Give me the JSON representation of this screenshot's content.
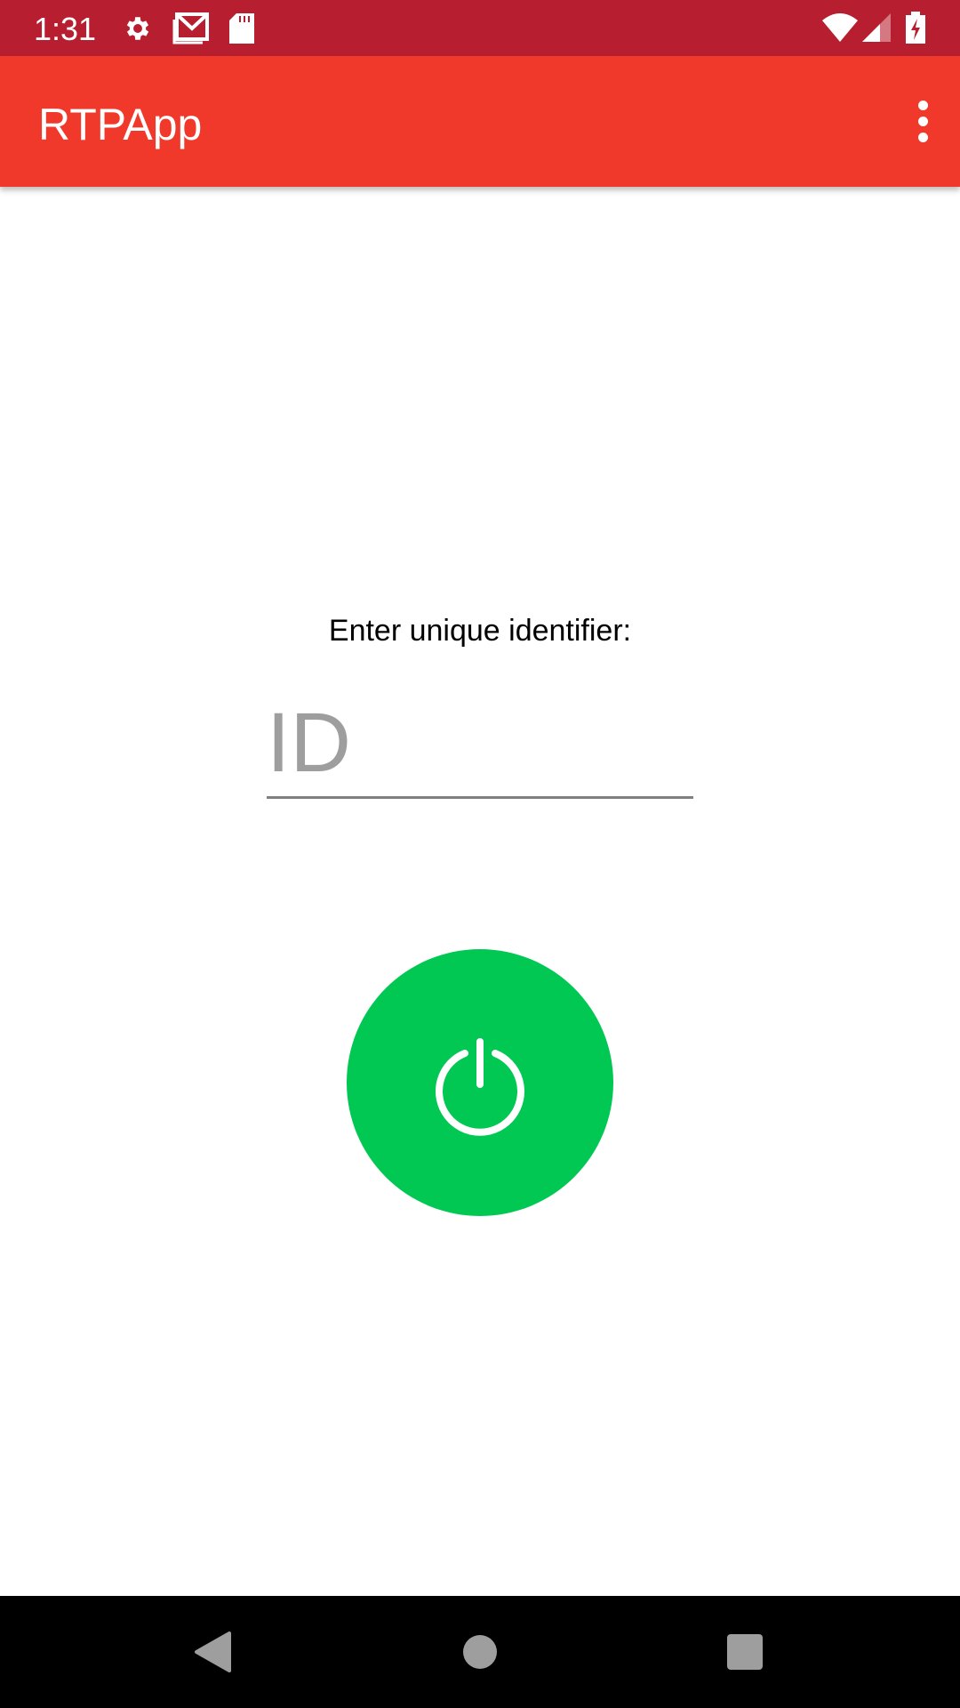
{
  "status_bar": {
    "time": "1:31",
    "icons": [
      "settings-icon",
      "gmail-icon",
      "sd-card-icon",
      "wifi-icon",
      "signal-icon",
      "battery-charging-icon"
    ]
  },
  "app_bar": {
    "title": "RTPApp",
    "menu_icon": "more-vert-icon"
  },
  "main": {
    "prompt_label": "Enter unique identifier:",
    "id_input": {
      "value": "",
      "placeholder": "ID"
    },
    "power_button": {
      "icon": "power-icon",
      "color": "#00c853"
    }
  },
  "nav_bar": {
    "buttons": [
      "back",
      "home",
      "recents"
    ]
  },
  "colors": {
    "status_bar": "#b71f30",
    "app_bar": "#f0392b"
  }
}
